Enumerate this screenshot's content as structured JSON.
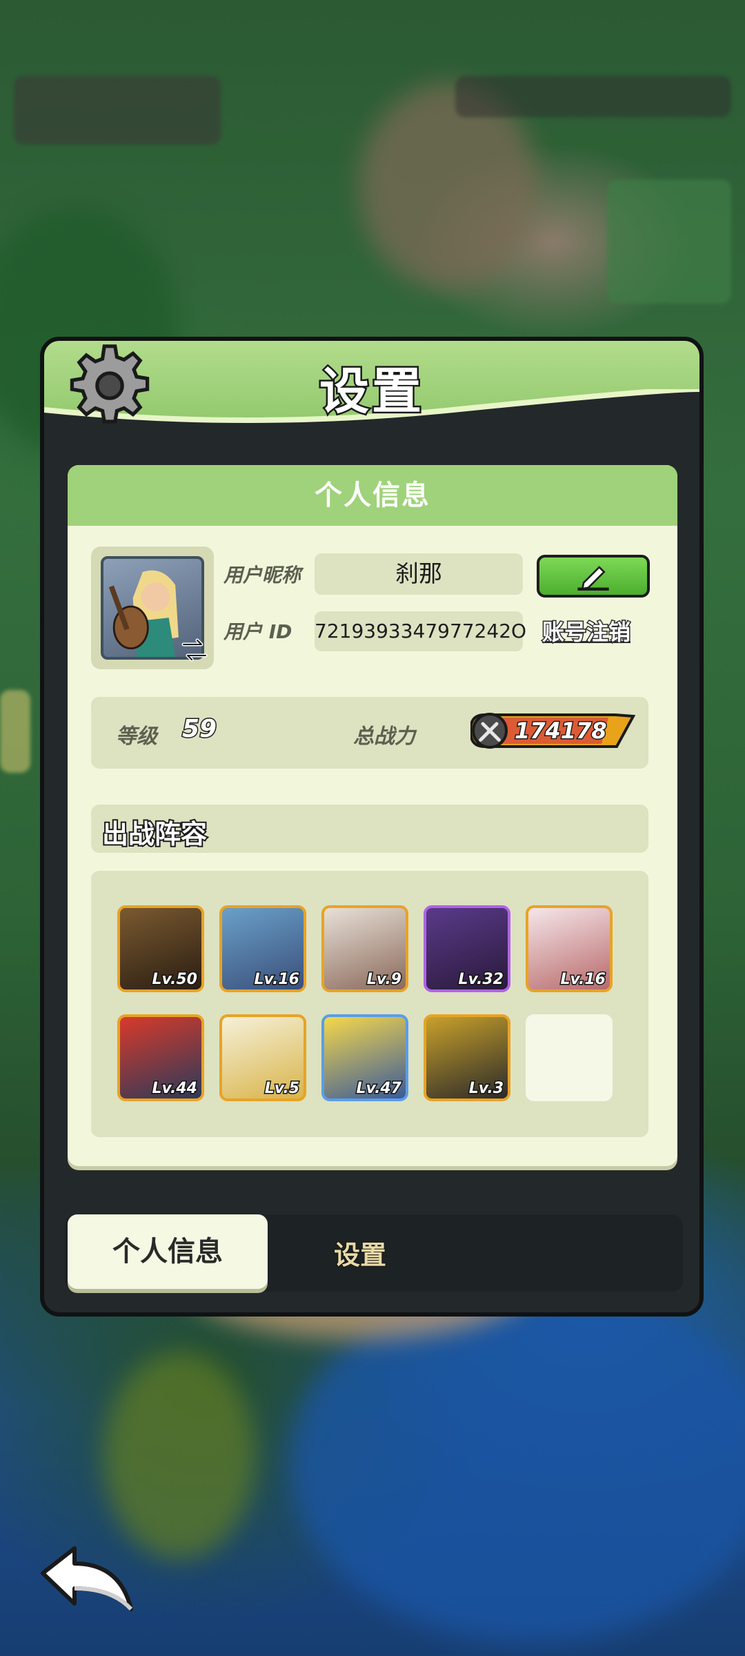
{
  "dialog": {
    "title": "设置",
    "section_header": "个人信息"
  },
  "profile": {
    "nickname_label": "用户昵称",
    "nickname": "刹那",
    "id_label": "用户 ID",
    "user_id": "7219393347977242O",
    "cancel_account": "账号注销"
  },
  "stats": {
    "level_label": "等级",
    "level": "59",
    "power_label": "总战力",
    "power": "174178"
  },
  "lineup": {
    "title": "出战阵容",
    "heroes": [
      {
        "level": "Lv.50",
        "frame": "orange"
      },
      {
        "level": "Lv.16",
        "frame": "orange"
      },
      {
        "level": "Lv.9",
        "frame": "orange"
      },
      {
        "level": "Lv.32",
        "frame": "purple"
      },
      {
        "level": "Lv.16",
        "frame": "orange"
      },
      {
        "level": "Lv.44",
        "frame": "orange"
      },
      {
        "level": "Lv.5",
        "frame": "orange"
      },
      {
        "level": "Lv.47",
        "frame": "blue"
      },
      {
        "level": "Lv.3",
        "frame": "orange"
      }
    ]
  },
  "tabs": {
    "active": "个人信息",
    "inactive": "设置"
  },
  "colors": {
    "header_green": "#9fd27a",
    "card_bg": "#f2f7dc",
    "edit_green": "#4cae2e",
    "frame_orange": "#e8a325",
    "frame_purple": "#b063e6",
    "frame_blue": "#5a9de8"
  },
  "icons": [
    "gear-icon",
    "swap-icon",
    "pencil-icon",
    "sword-icon",
    "back-arrow-icon"
  ]
}
